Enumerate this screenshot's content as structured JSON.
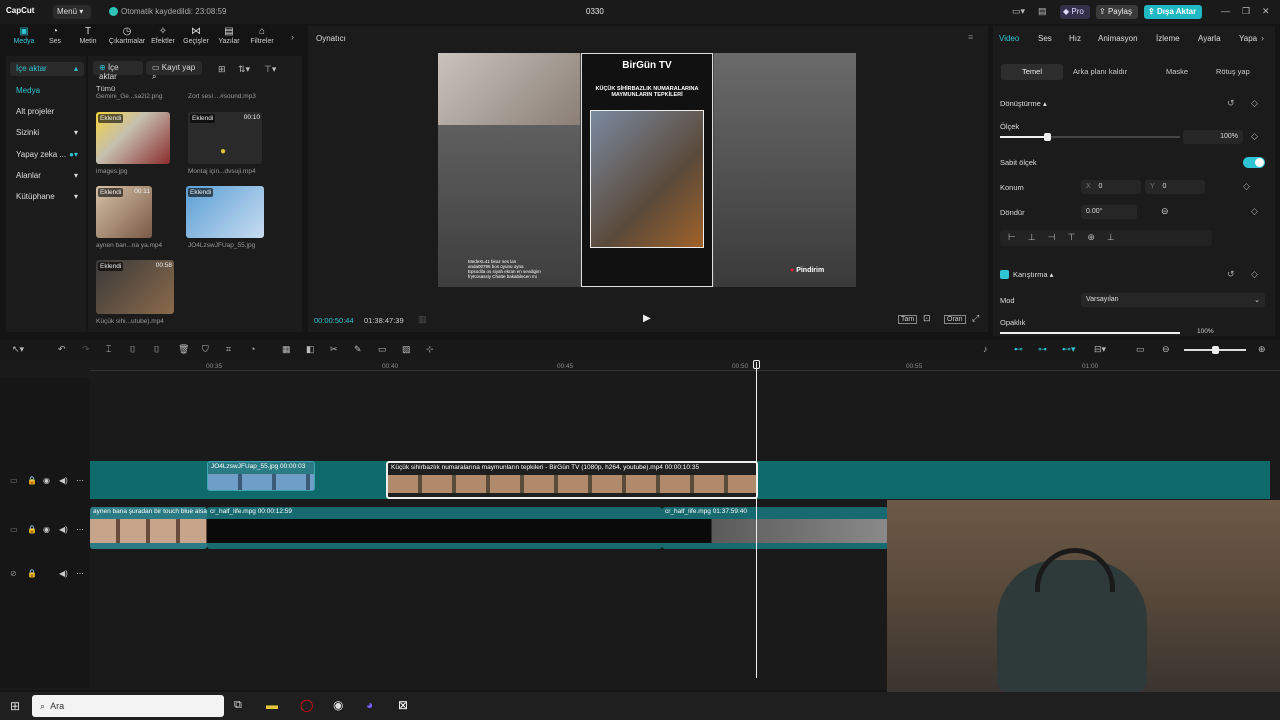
{
  "titlebar": {
    "app_name": "CapCut",
    "menu_label": "Menü",
    "autosave_text": "Otomatik kaydedildi: 23:08:59",
    "project_name": "0330",
    "pro_label": "Pro",
    "share_label": "Paylaş",
    "export_label": "Dışa Aktar"
  },
  "toolbar": {
    "items": [
      "Medya",
      "Ses",
      "Metin",
      "Çıkartmalar",
      "Efektler",
      "Geçişler",
      "Yazılar",
      "Filtreler"
    ]
  },
  "leftnav": {
    "items": [
      "İçe aktar",
      "Medya",
      "Alt projeler",
      "Sizinki",
      "Yapay zeka ...",
      "Alanlar",
      "Kütüphane"
    ]
  },
  "media": {
    "import_label": "İçe aktar",
    "record_label": "Kayıt yap",
    "all_label": "Tümü",
    "top_files": [
      "Gemini_Ge...sa2i2.png",
      "Zort sesi ...#sound.mp3"
    ],
    "added_badge": "Eklendi",
    "items": [
      {
        "name": "images.jpg",
        "duration": ""
      },
      {
        "name": "Montaj için...dvsuji.mp4",
        "duration": "00:10"
      },
      {
        "name": "aynen ban...na ya.mp4",
        "duration": "00:11"
      },
      {
        "name": "JO4LzswJFUap_55.jpg",
        "duration": ""
      },
      {
        "name": "Küçük sihi...utube).mp4",
        "duration": "00:58"
      }
    ]
  },
  "player": {
    "title": "Oynatıcı",
    "current_time": "00:00:50:44",
    "total_time": "01:38:47:39",
    "btn_full": "Tam",
    "btn_ratio": "Oran",
    "video_brand": "BirGün TV",
    "video_headline": "KÜÇÜK SİHİRBAZLIK NUMARALARINA MAYMUNLARIN TEPKİLERİ",
    "video_watermark": "Pindirim",
    "chat_lines": [
      "MedeXL41 biraz ses lan",
      "anda00795 bos oyunu oyna",
      "Epsodila os siyah ekran en sevdigim",
      "fryKosassiy Chatte bakabilecen mi"
    ]
  },
  "rightpanel": {
    "tabs": [
      "Video",
      "Ses",
      "Hız",
      "Animasyon",
      "İzleme",
      "Ayarla",
      "Yapa"
    ],
    "subtabs": [
      "Temel",
      "Arka planı kaldır",
      "Maske",
      "Rötuş yap"
    ],
    "transform_label": "Dönüştürme",
    "scale_label": "Ölçek",
    "scale_value": "100%",
    "scale_fraction": 0.26,
    "uniform_label": "Sabit ölçek",
    "position_label": "Konum",
    "pos_x_label": "X",
    "pos_x": "0",
    "pos_y_label": "Y",
    "pos_y": "0",
    "rotate_label": "Döndür",
    "rotate_value": "0.00°",
    "blend_label": "Karıştırma",
    "mode_label": "Mod",
    "mode_value": "Varsayılan",
    "opacity_label": "Opaklık",
    "opacity_value": "100%"
  },
  "timeline": {
    "ruler": [
      "00:35",
      "00:40",
      "00:45",
      "00:50",
      "00:55",
      "01:00"
    ],
    "clips_top": [
      {
        "label": "JO4LzswJFUap_55.jpg  00:00:03"
      },
      {
        "label": "Küçük sihirbazlık numaralarına maymunların tepkileri - BirGün TV (1080p, h264, youtube).mp4  00:00:10:35"
      }
    ],
    "clips_main": [
      {
        "label": "aynen bana şuradan bir touch blue alsa"
      },
      {
        "label": "cr_half_life.mpg  00:00:12:59"
      },
      {
        "label": "cr_half_life.mpg  01:37:59:40"
      }
    ]
  },
  "taskbar": {
    "search_label": "Ara"
  }
}
